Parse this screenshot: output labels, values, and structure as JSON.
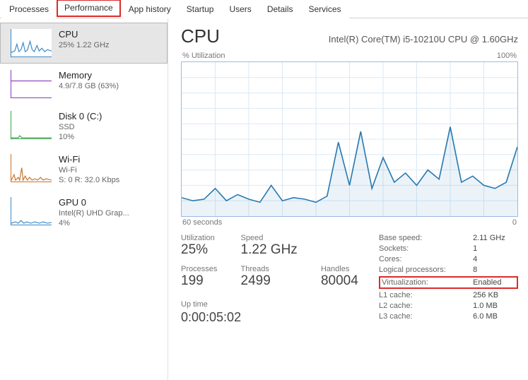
{
  "tabs": [
    {
      "label": "Processes"
    },
    {
      "label": "Performance"
    },
    {
      "label": "App history"
    },
    {
      "label": "Startup"
    },
    {
      "label": "Users"
    },
    {
      "label": "Details"
    },
    {
      "label": "Services"
    }
  ],
  "sidebar": {
    "items": [
      {
        "title": "CPU",
        "sub": "25%  1.22 GHz"
      },
      {
        "title": "Memory",
        "sub": "4.9/7.8 GB (63%)"
      },
      {
        "title": "Disk 0 (C:)",
        "sub1": "SSD",
        "sub2": "10%"
      },
      {
        "title": "Wi-Fi",
        "sub1": "Wi-Fi",
        "sub2": "S: 0 R: 32.0 Kbps"
      },
      {
        "title": "GPU 0",
        "sub1": "Intel(R) UHD Grap...",
        "sub2": "4%"
      }
    ]
  },
  "main": {
    "title": "CPU",
    "subtitle": "Intel(R) Core(TM) i5-10210U CPU @ 1.60GHz",
    "graph": {
      "y_label": "% Utilization",
      "y_max": "100%",
      "x_left": "60 seconds",
      "x_right": "0"
    },
    "stats": {
      "utilization_label": "Utilization",
      "utilization_value": "25%",
      "speed_label": "Speed",
      "speed_value": "1.22 GHz",
      "processes_label": "Processes",
      "processes_value": "199",
      "threads_label": "Threads",
      "threads_value": "2499",
      "handles_label": "Handles",
      "handles_value": "80004",
      "uptime_label": "Up time",
      "uptime_value": "0:00:05:02"
    },
    "right_stats": {
      "base_speed_l": "Base speed:",
      "base_speed_v": "2.11 GHz",
      "sockets_l": "Sockets:",
      "sockets_v": "1",
      "cores_l": "Cores:",
      "cores_v": "4",
      "logical_l": "Logical processors:",
      "logical_v": "8",
      "virt_l": "Virtualization:",
      "virt_v": "Enabled",
      "l1_l": "L1 cache:",
      "l1_v": "256 KB",
      "l2_l": "L2 cache:",
      "l2_v": "1.0 MB",
      "l3_l": "L3 cache:",
      "l3_v": "6.0 MB"
    }
  },
  "chart_data": {
    "type": "line",
    "title": "% Utilization",
    "xlabel": "seconds",
    "ylabel": "% Utilization",
    "xlim": [
      60,
      0
    ],
    "ylim": [
      0,
      100
    ],
    "x": [
      60,
      58,
      56,
      54,
      52,
      50,
      48,
      46,
      44,
      42,
      40,
      38,
      36,
      34,
      32,
      30,
      28,
      26,
      24,
      22,
      20,
      18,
      16,
      14,
      12,
      10,
      8,
      6,
      4,
      2,
      0
    ],
    "values": [
      12,
      10,
      11,
      18,
      10,
      14,
      11,
      9,
      20,
      10,
      12,
      11,
      9,
      13,
      48,
      20,
      55,
      18,
      38,
      22,
      28,
      20,
      30,
      24,
      58,
      22,
      26,
      20,
      18,
      22,
      45
    ]
  }
}
